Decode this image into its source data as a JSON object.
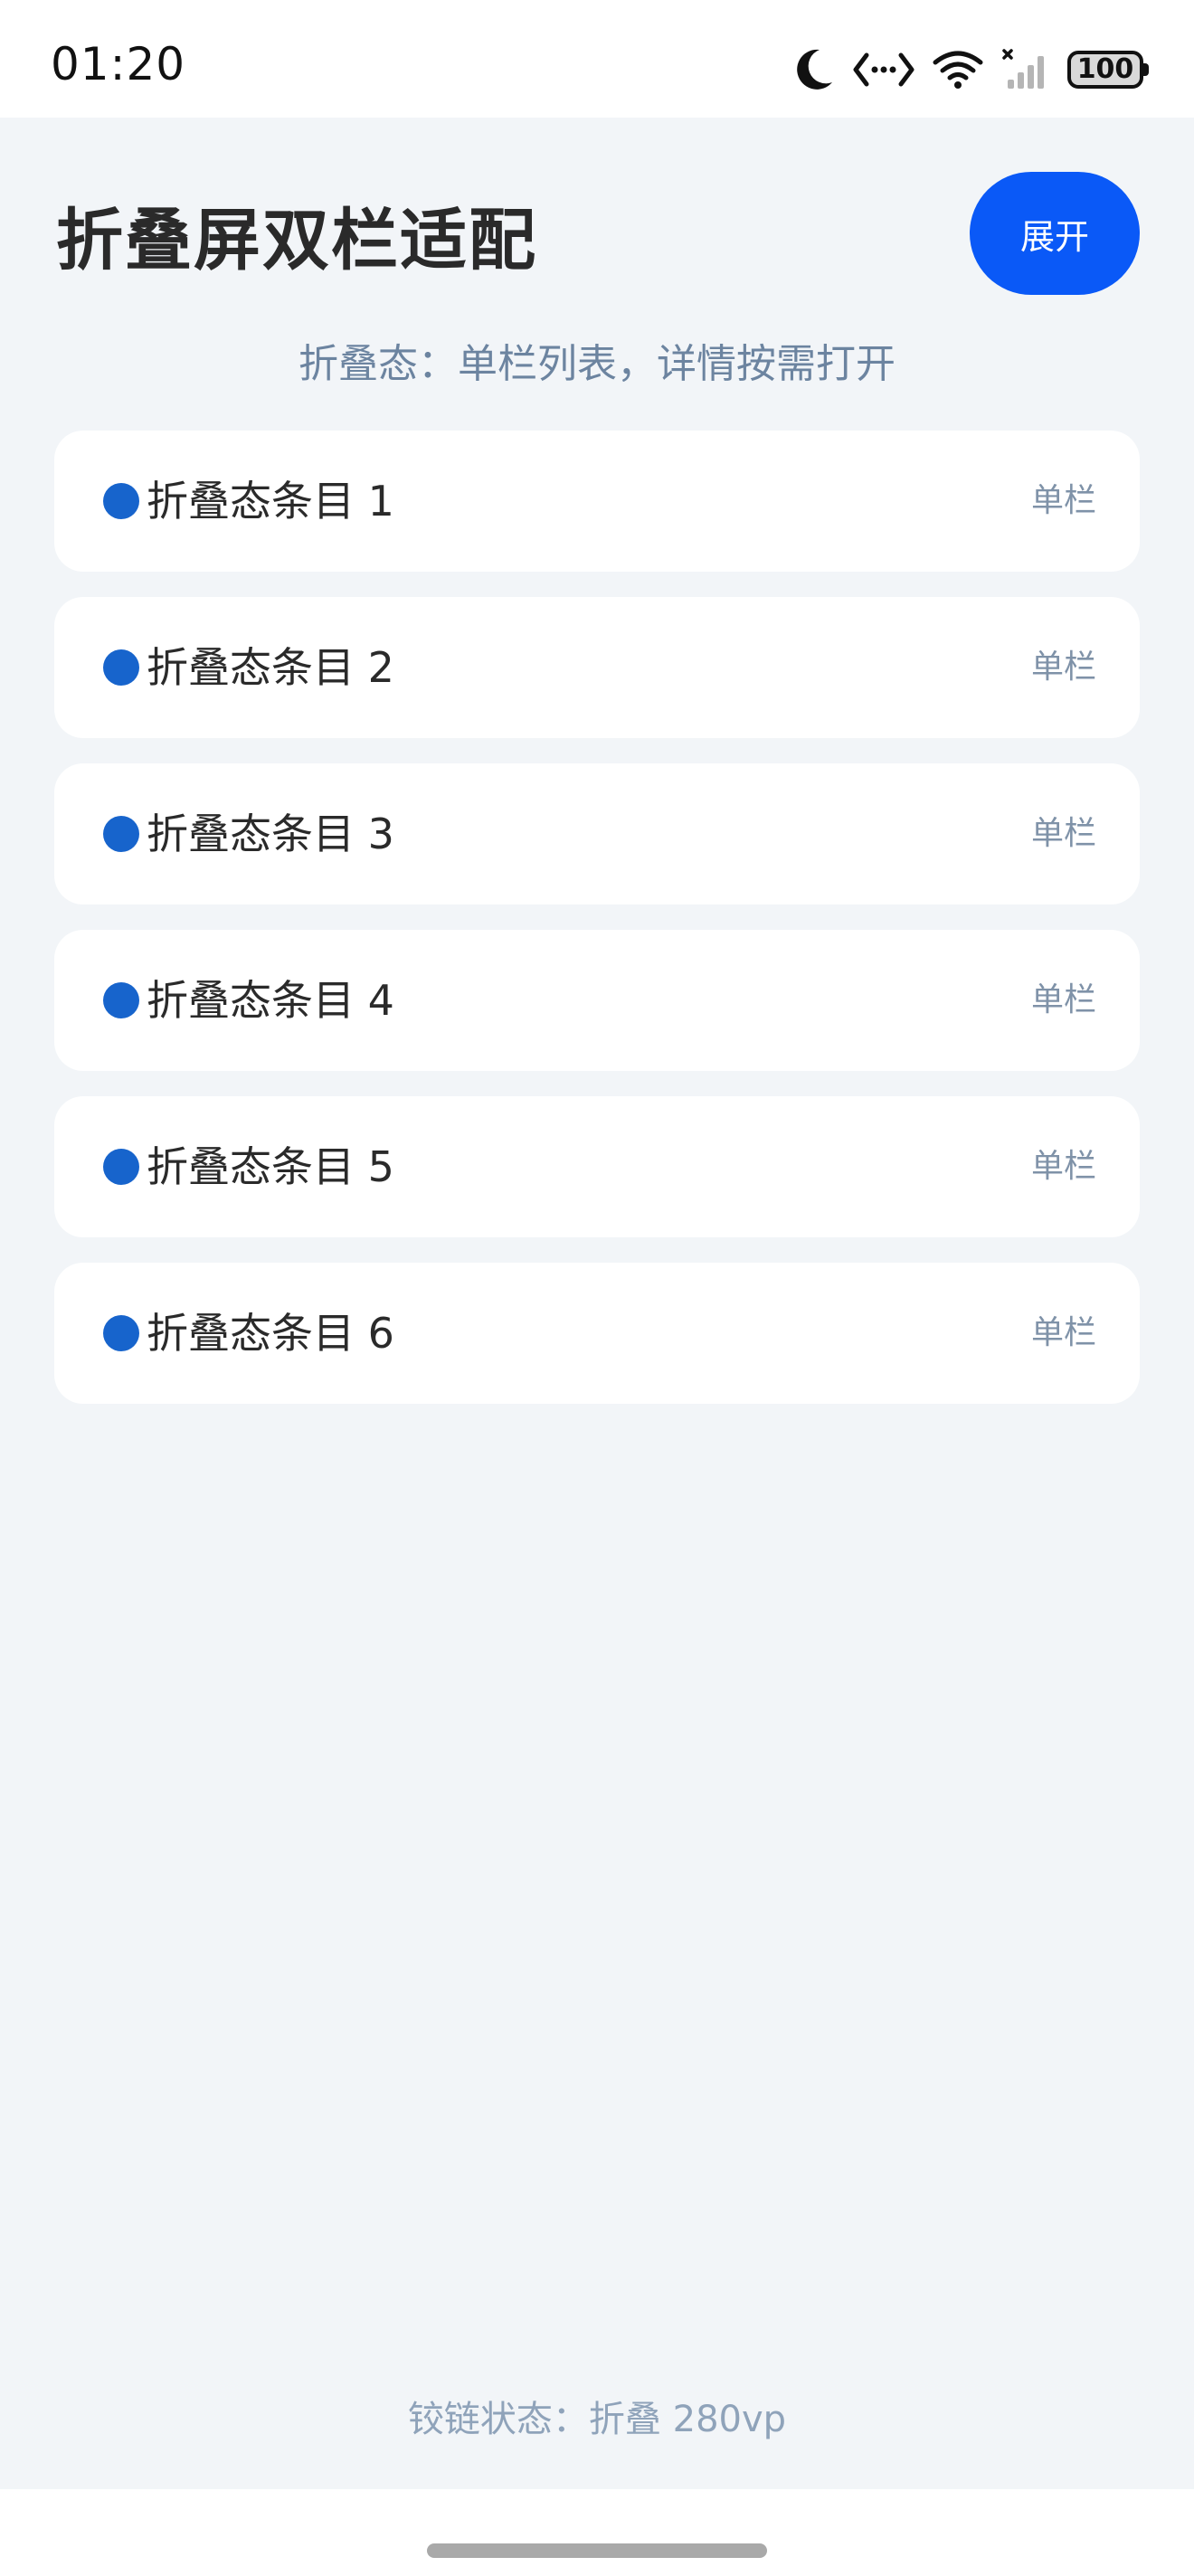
{
  "status_bar": {
    "time": "01:20",
    "battery": "100",
    "icons": [
      "moon-icon",
      "code-icon",
      "wifi-icon",
      "cellular-no-service-icon",
      "battery-icon"
    ]
  },
  "header": {
    "title": "折叠屏双栏适配",
    "expand_label": "展开"
  },
  "subtitle": "折叠态：单栏列表，详情按需打开",
  "list": {
    "dot_color": "#1764cc",
    "items": [
      {
        "label": "折叠态条目 1",
        "tag": "单栏"
      },
      {
        "label": "折叠态条目 2",
        "tag": "单栏"
      },
      {
        "label": "折叠态条目 3",
        "tag": "单栏"
      },
      {
        "label": "折叠态条目 4",
        "tag": "单栏"
      },
      {
        "label": "折叠态条目 5",
        "tag": "单栏"
      },
      {
        "label": "折叠态条目 6",
        "tag": "单栏"
      }
    ]
  },
  "footer": {
    "hinge_status": "铰链状态：折叠 280vp"
  },
  "colors": {
    "accent": "#0a59f7",
    "background": "#f2f5f8",
    "card": "#ffffff"
  }
}
